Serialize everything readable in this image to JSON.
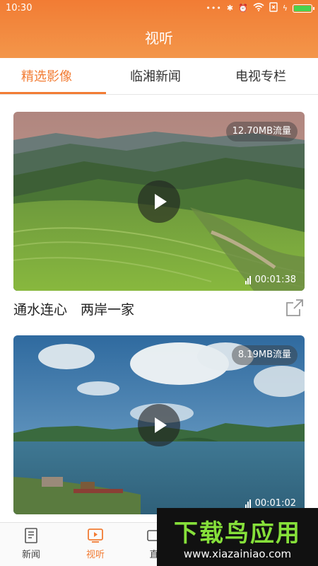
{
  "status_bar": {
    "time": "10:30",
    "icons": [
      "dots-icon",
      "bluetooth-icon",
      "alarm-icon",
      "wifi-icon",
      "sim-icon",
      "charging-icon",
      "battery-icon"
    ]
  },
  "header": {
    "title": "视听"
  },
  "tabs": [
    {
      "label": "精选影像",
      "active": true
    },
    {
      "label": "临湘新闻",
      "active": false
    },
    {
      "label": "电视专栏",
      "active": false
    }
  ],
  "videos": [
    {
      "title": "通水连心　两岸一家",
      "size": "12.70MB流量",
      "duration": "00:01:38"
    },
    {
      "title": "",
      "size": "8.19MB流量",
      "duration": "00:01:02"
    }
  ],
  "bottom_nav": [
    {
      "label": "新闻",
      "icon": "news-icon",
      "active": false
    },
    {
      "label": "视听",
      "icon": "video-icon",
      "active": true
    },
    {
      "label": "直",
      "icon": "live-icon",
      "active": false
    }
  ],
  "watermark": {
    "title": "下载鸟应用",
    "url": "www.xiazainiao.com"
  },
  "colors": {
    "accent": "#f27c34",
    "header_gradient_top": "#f27c34",
    "header_gradient_bottom": "#f3964a",
    "watermark_green": "#86e03a"
  }
}
